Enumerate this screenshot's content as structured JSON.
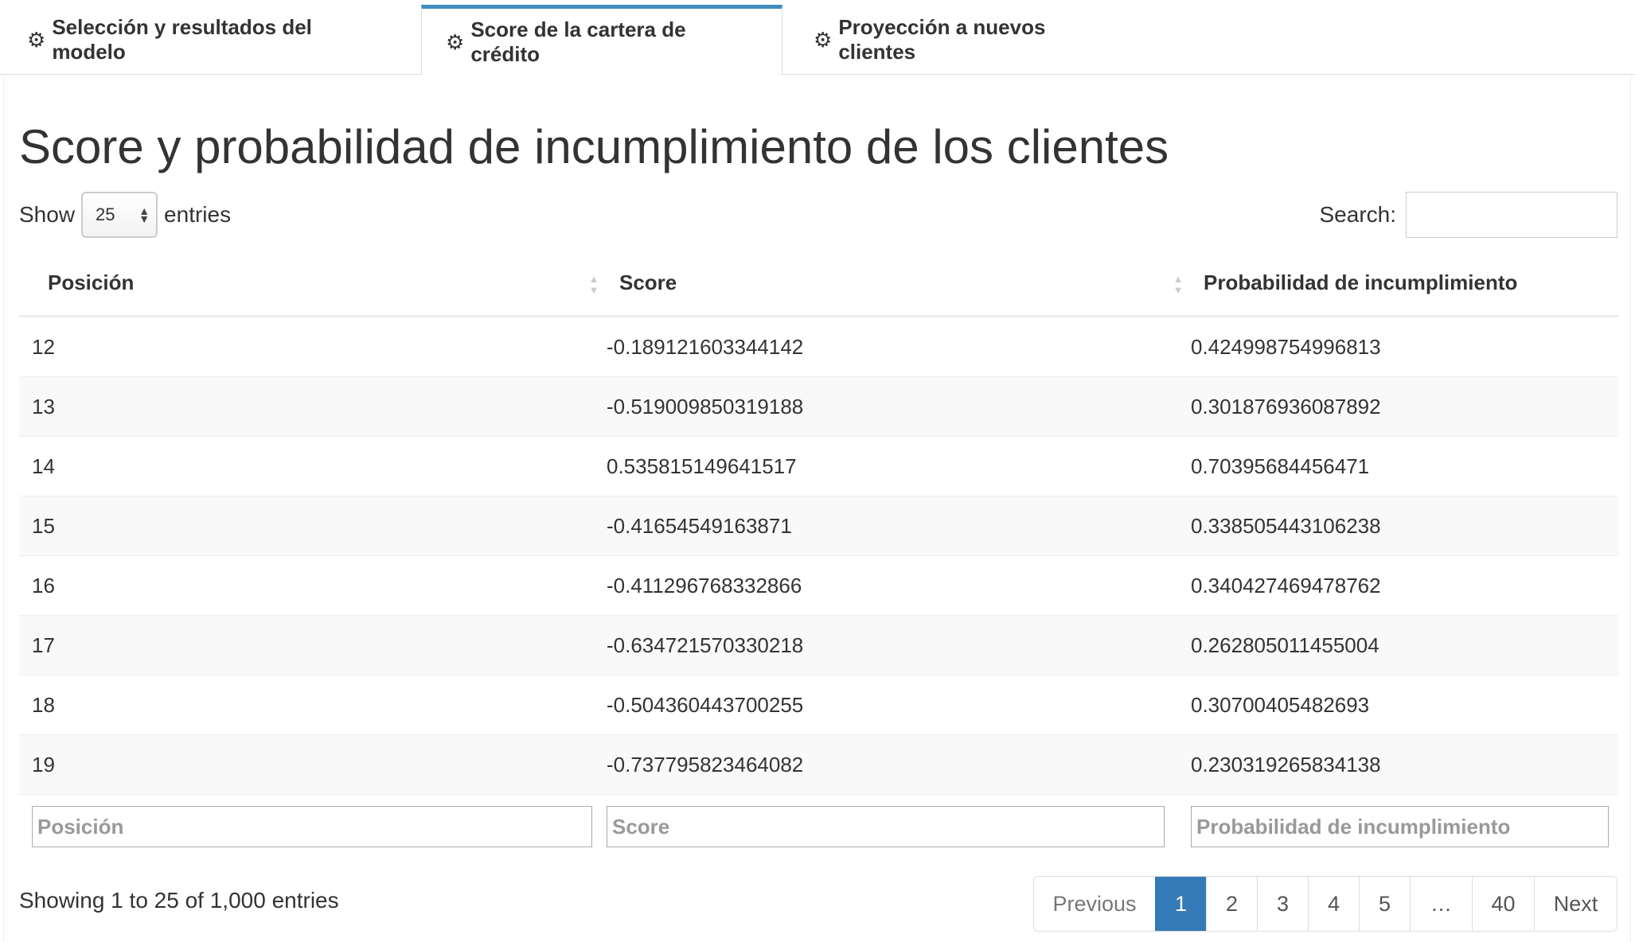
{
  "tabs": [
    {
      "label": "Selección y resultados del modelo",
      "icon": "gear-icon"
    },
    {
      "label": "Score de la cartera de crédito",
      "icon": "gear-icon",
      "active": true
    },
    {
      "label": "Proyección a nuevos clientes",
      "icon": "gear-icon"
    }
  ],
  "main": {
    "title": "Score y probabilidad de incumplimiento de los clientes",
    "show_label": "Show",
    "entries_value": "25",
    "entries_label": "entries",
    "search_label": "Search:",
    "search_value": ""
  },
  "table": {
    "headers": [
      "Posición",
      "Score",
      "Probabilidad de incumplimiento"
    ],
    "rows": [
      [
        "12",
        "-0.189121603344142",
        "0.424998754996813"
      ],
      [
        "13",
        "-0.519009850319188",
        "0.301876936087892"
      ],
      [
        "14",
        "0.535815149641517",
        "0.70395684456471"
      ],
      [
        "15",
        "-0.41654549163871",
        "0.338505443106238"
      ],
      [
        "16",
        "-0.411296768332866",
        "0.340427469478762"
      ],
      [
        "17",
        "-0.634721570330218",
        "0.262805011455004"
      ],
      [
        "18",
        "-0.504360443700255",
        "0.30700405482693"
      ],
      [
        "19",
        "-0.737795823464082",
        "0.230319265834138"
      ]
    ],
    "filter_placeholders": [
      "Posición",
      "Score",
      "Probabilidad de incumplimiento"
    ]
  },
  "footer": {
    "info": "Showing 1 to 25 of 1,000 entries",
    "pagination": {
      "previous": "Previous",
      "pages": [
        "1",
        "2",
        "3",
        "4",
        "5",
        "…",
        "40"
      ],
      "current": "1",
      "next": "Next"
    }
  },
  "colors": {
    "accent": "#3c8dbc",
    "page_active": "#337ab7",
    "stripe": "#f9f9f9"
  }
}
